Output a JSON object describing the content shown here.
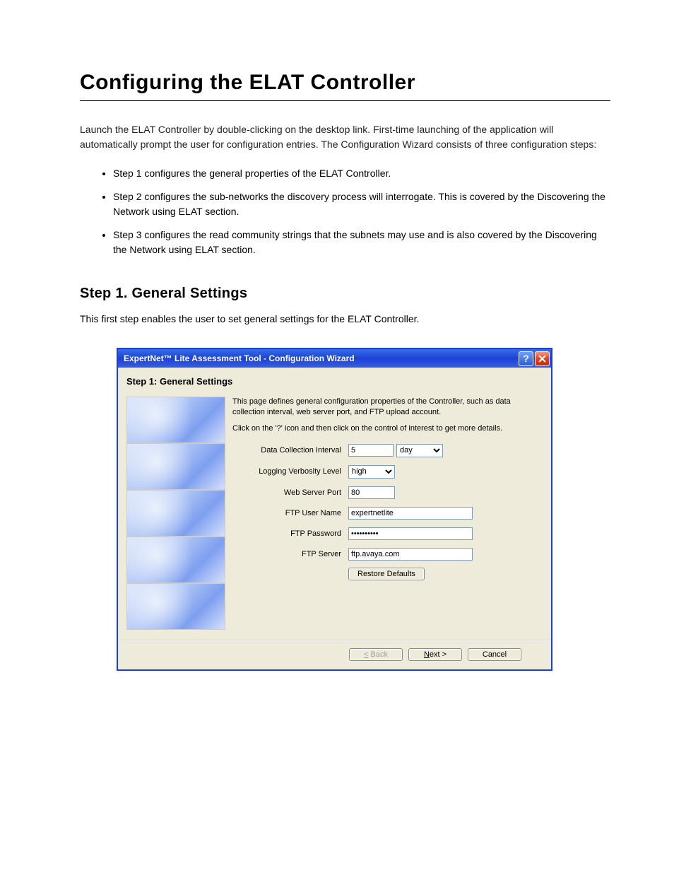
{
  "doc": {
    "title": "Configuring the ELAT Controller",
    "intro": "Launch the ELAT Controller by double-clicking on the desktop link. First-time launching of the application will automatically prompt the user for configuration entries. The Configuration Wizard consists of three configuration steps:",
    "bullets": [
      "Step 1 configures the general properties of the ELAT Controller.",
      "Step 2 configures the sub-networks the discovery process will interrogate. This is covered by the Discovering the Network using ELAT section.",
      "Step 3 configures the read community strings that the subnets may use and is also covered by the Discovering the Network using ELAT section."
    ],
    "step_heading": "Step 1. General Settings",
    "step_desc": "This first step enables the user to set general settings for the ELAT Controller."
  },
  "dialog": {
    "title": "ExpertNet™ Lite Assessment Tool - Configuration Wizard",
    "step_label": "Step 1: General Settings",
    "intro1": "This page defines general configuration properties of the Controller, such as data collection interval, web server port, and FTP upload account.",
    "intro2": "Click on the '?' icon and then click on the control of interest to get more details.",
    "fields": {
      "data_interval_label": "Data Collection Interval",
      "data_interval_value": "5",
      "data_interval_unit": "day",
      "log_level_label": "Logging Verbosity Level",
      "log_level_value": "high",
      "web_port_label": "Web Server Port",
      "web_port_value": "80",
      "ftp_user_label": "FTP User Name",
      "ftp_user_value": "expertnetlite",
      "ftp_pass_label": "FTP Password",
      "ftp_pass_value": "xxxxxxxxxx",
      "ftp_server_label": "FTP Server",
      "ftp_server_value": "ftp.avaya.com"
    },
    "buttons": {
      "restore": "Restore Defaults",
      "back": "< Back",
      "next": "Next >",
      "cancel": "Cancel"
    }
  }
}
